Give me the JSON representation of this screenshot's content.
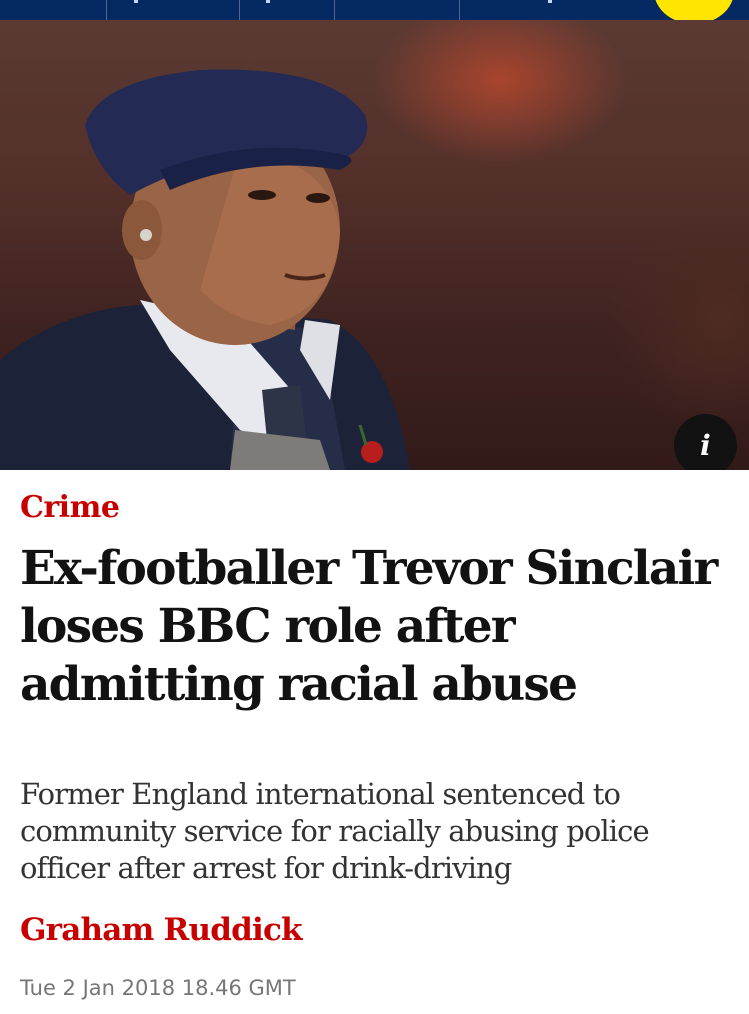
{
  "article": {
    "section": "Crime",
    "headline": "Ex-footballer Trevor Sinclair loses BBC role after admitting racial abuse",
    "standfirst": "Former England international sentenced to community service for racially abusing police officer after arrest for drink-driving",
    "byline": "Graham Ruddick",
    "date": "Tue 2 Jan 2018 18.46 GMT"
  },
  "hero": {
    "info_label": "i",
    "info_icon": "info-icon"
  },
  "colors": {
    "nav_background": "#052962",
    "accent_yellow": "#ffe500",
    "section_red": "#c70000",
    "headline_text": "#121212",
    "meta_grey": "#767676"
  }
}
